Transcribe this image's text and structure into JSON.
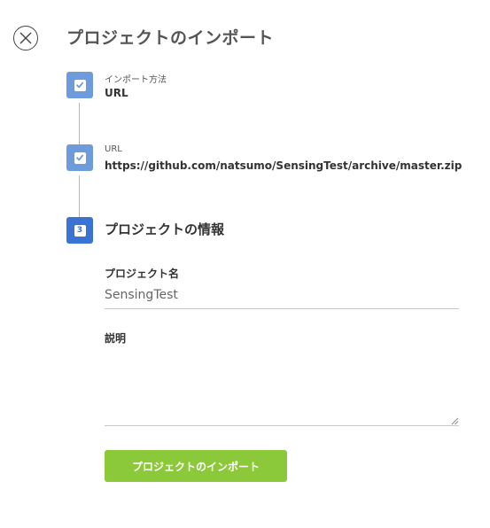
{
  "header": {
    "title": "プロジェクトのインポート",
    "close_icon": "close-circle-icon"
  },
  "steps": [
    {
      "status": "complete",
      "icon": "check-icon",
      "label": "インポート方法",
      "value": "URL"
    },
    {
      "status": "complete",
      "icon": "check-icon",
      "label": "URL",
      "value": "https://github.com/natsumo/SensingTest/archive/master.zip"
    },
    {
      "status": "active",
      "number": "3",
      "title": "プロジェクトの情報"
    }
  ],
  "form": {
    "name_label": "プロジェクト名",
    "name_value": "SensingTest",
    "description_label": "説明",
    "description_value": "",
    "submit_label": "プロジェクトのインポート"
  },
  "colors": {
    "step_done": "#6e9bdc",
    "step_active": "#3a73d1",
    "submit_button": "#8bc93a",
    "title_text": "#555555"
  }
}
